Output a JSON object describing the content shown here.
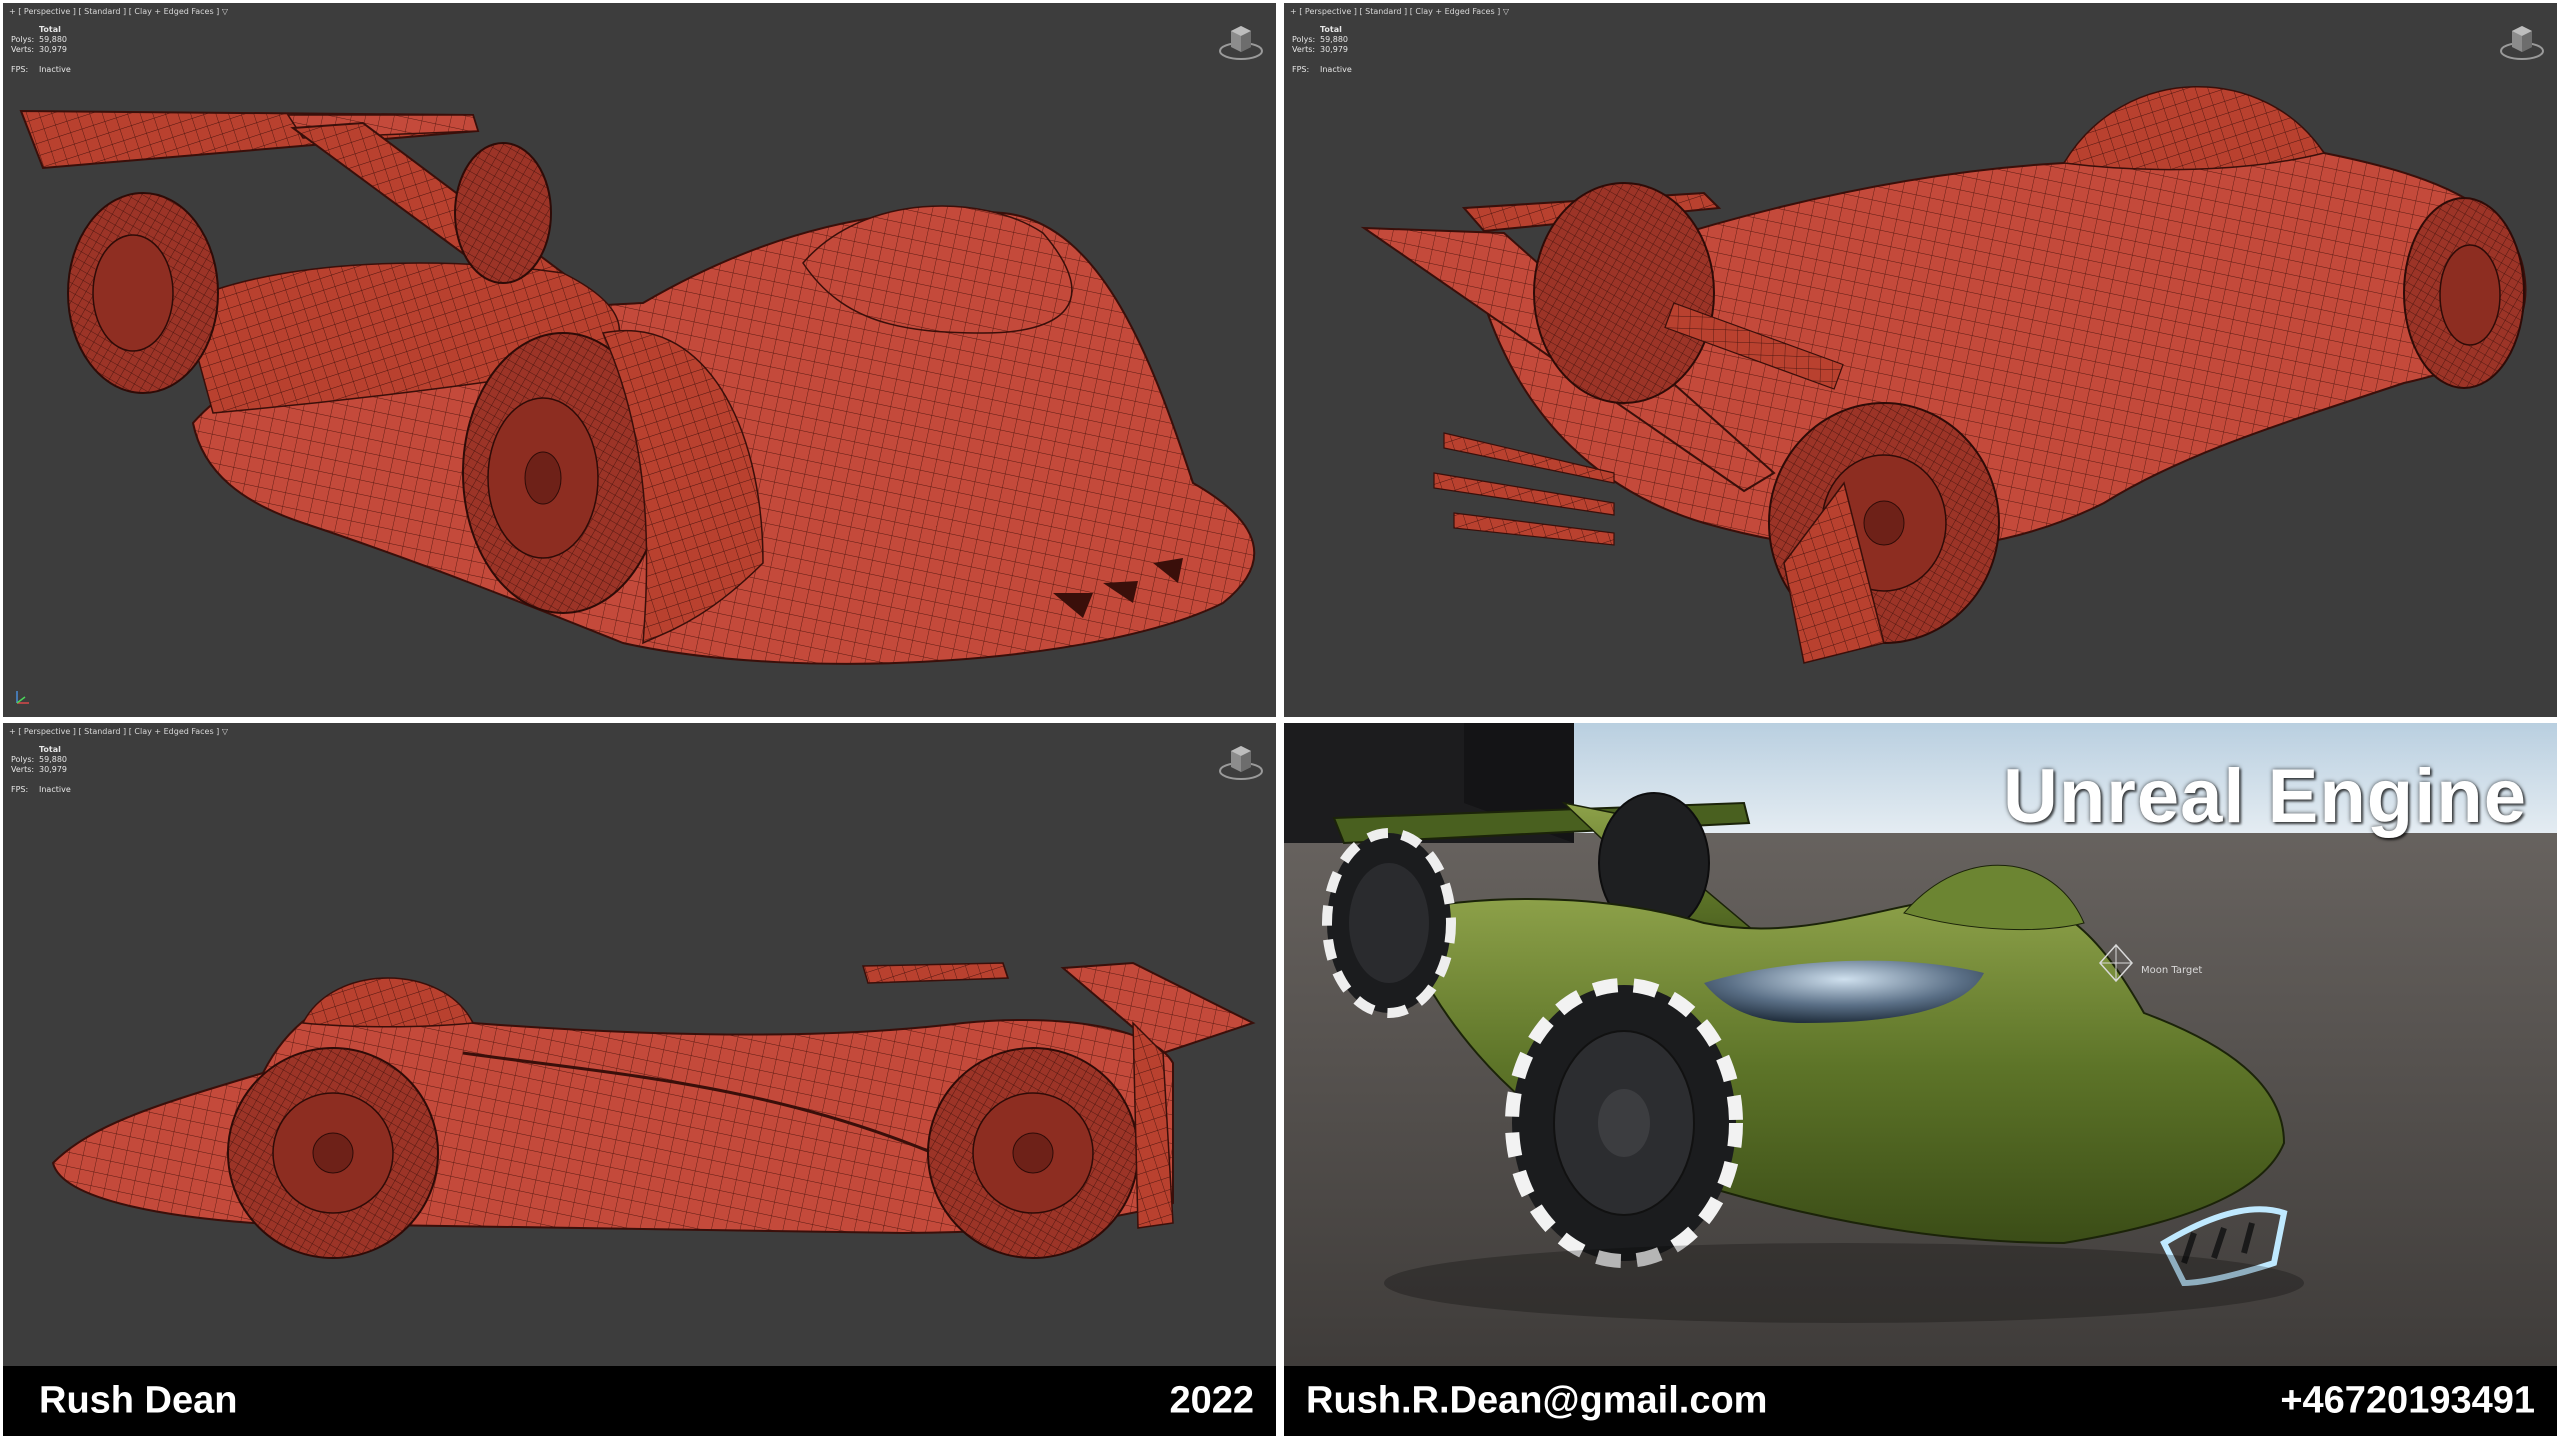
{
  "colors": {
    "viewport_bg": "#3d3d3d",
    "clay_red": "#c9493a",
    "car_green": "#5f7a2c",
    "bar_bg": "#000000",
    "bar_text": "#ffffff"
  },
  "viewports": [
    {
      "label": "+ [ Perspective ] [ Standard ] [ Clay + Edged Faces ]  ▽",
      "stats": {
        "header": "Total",
        "polys_label": "Polys:",
        "polys": "59,880",
        "verts_label": "Verts:",
        "verts": "30,979",
        "fps_label": "FPS:",
        "fps": "Inactive"
      }
    },
    {
      "label": "+ [ Perspective ] [ Standard ] [ Clay + Edged Faces ]  ▽",
      "stats": {
        "header": "Total",
        "polys_label": "Polys:",
        "polys": "59,880",
        "verts_label": "Verts:",
        "verts": "30,979",
        "fps_label": "FPS:",
        "fps": "Inactive"
      }
    },
    {
      "label": "+ [ Perspective ] [ Standard ] [ Clay + Edged Faces ]  ▽",
      "stats": {
        "header": "Total",
        "polys_label": "Polys:",
        "polys": "59,880",
        "verts_label": "Verts:",
        "verts": "30,979",
        "fps_label": "FPS:",
        "fps": "Inactive"
      }
    }
  ],
  "render": {
    "title": "Unreal Engine",
    "target_label": "Moon Target"
  },
  "footer": {
    "name": "Rush Dean",
    "year": "2022",
    "email": "Rush.R.Dean@gmail.com",
    "phone": "+46720193491"
  }
}
